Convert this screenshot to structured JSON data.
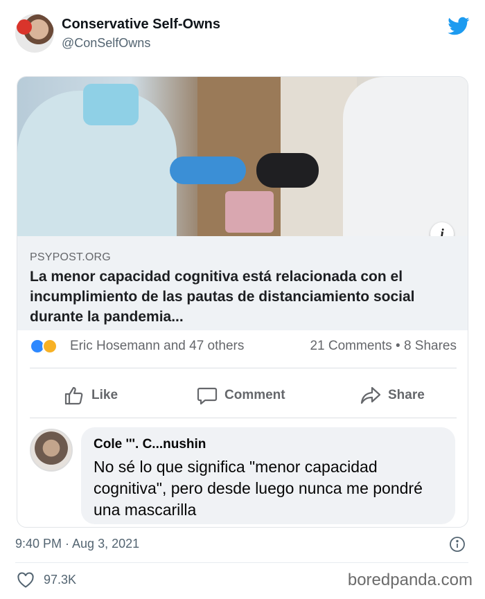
{
  "tweet": {
    "display_name": "Conservative Self-Owns",
    "handle": "@ConSelfOwns",
    "timestamp": "9:40 PM · Aug 3, 2021",
    "likes": "97.3K",
    "brand_color": "#1d9bf0"
  },
  "post": {
    "source": "PSYPOST.ORG",
    "headline": "La menor capacidad cognitiva está relacionada con el incumplimiento de las pautas de distanciamiento social durante la pandemia...",
    "reactions_text": "Eric Hosemann and 47 others",
    "counts_text": "21 Comments • 8 Shares",
    "actions": {
      "like": "Like",
      "comment": "Comment",
      "share": "Share"
    }
  },
  "comment": {
    "author": "Cole '''. C...nushin",
    "text": "No sé lo que significa \"menor capacidad cognitiva\", pero desde luego nunca me pondré una mascarilla"
  },
  "watermark": "boredpanda.com",
  "icons": [
    "twitter-bird-icon",
    "info-icon",
    "like-reaction-icon",
    "haha-reaction-icon",
    "thumbs-up-icon",
    "comment-icon",
    "share-icon",
    "info-circle-icon",
    "heart-icon"
  ]
}
